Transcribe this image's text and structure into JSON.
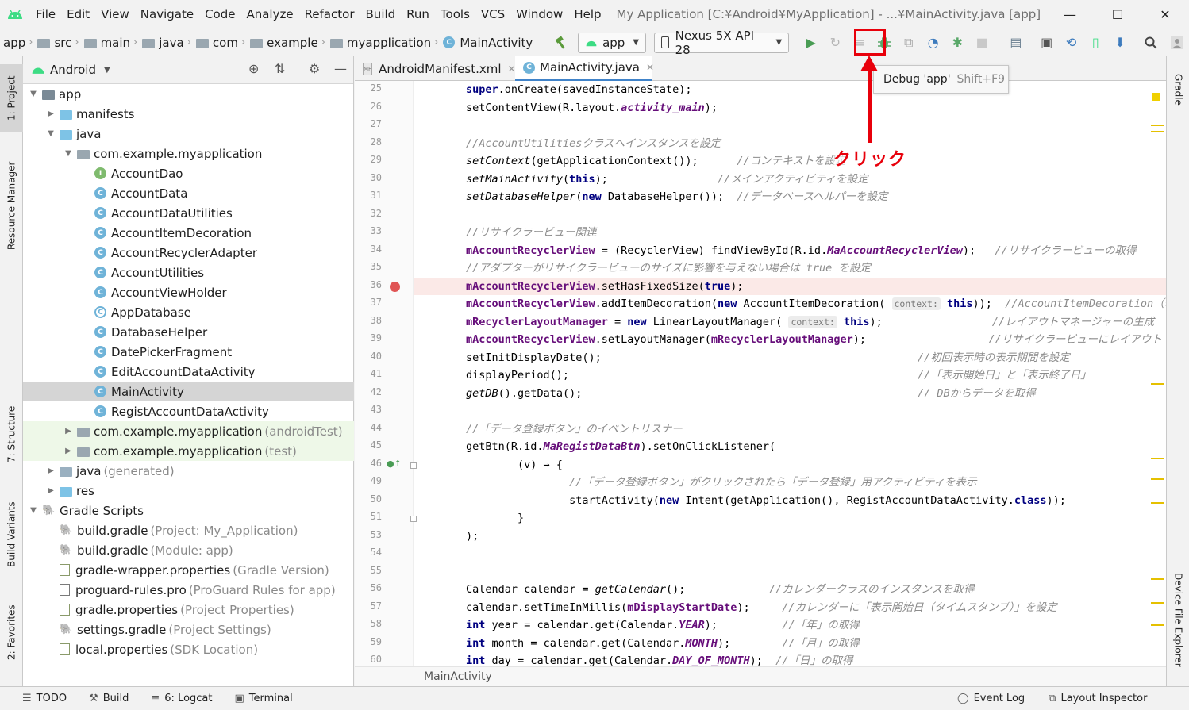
{
  "menubar": {
    "items": [
      {
        "label": "File"
      },
      {
        "label": "Edit"
      },
      {
        "label": "View"
      },
      {
        "label": "Navigate"
      },
      {
        "label": "Code"
      },
      {
        "label": "Analyze"
      },
      {
        "label": "Refactor"
      },
      {
        "label": "Build"
      },
      {
        "label": "Run"
      },
      {
        "label": "Tools"
      },
      {
        "label": "VCS"
      },
      {
        "label": "Window"
      },
      {
        "label": "Help"
      }
    ],
    "title": "My Application [C:¥Android¥MyApplication] - ...¥MainActivity.java [app]"
  },
  "navbar": {
    "crumbs": [
      "app",
      "src",
      "main",
      "java",
      "com",
      "example",
      "myapplication",
      "MainActivity"
    ],
    "run_config": "app",
    "device": "Nexus 5X API 28"
  },
  "tooltip": {
    "label": "Debug 'app'",
    "shortcut": "Shift+F9"
  },
  "annotation": {
    "text": "クリック",
    "color": "#e8000b"
  },
  "left_strip": {
    "tabs": [
      "1: Project",
      "Resource Manager",
      "7: Structure",
      "Build Variants",
      "2: Favorites"
    ]
  },
  "right_strip": {
    "tabs": [
      "Gradle",
      "Device File Explorer"
    ]
  },
  "project_panel": {
    "view": "Android",
    "tree": [
      {
        "label": "app",
        "hint": "",
        "type": "module",
        "indent": 0,
        "tw": "▼"
      },
      {
        "label": "manifests",
        "hint": "",
        "type": "folder",
        "indent": 1,
        "tw": "▶"
      },
      {
        "label": "java",
        "hint": "",
        "type": "folder",
        "indent": 1,
        "tw": "▼"
      },
      {
        "label": "com.example.myapplication",
        "hint": "",
        "type": "package",
        "indent": 2,
        "tw": "▼"
      },
      {
        "label": "AccountDao",
        "hint": "",
        "type": "interface",
        "indent": 3,
        "tw": ""
      },
      {
        "label": "AccountData",
        "hint": "",
        "type": "class",
        "indent": 3,
        "tw": ""
      },
      {
        "label": "AccountDataUtilities",
        "hint": "",
        "type": "class",
        "indent": 3,
        "tw": ""
      },
      {
        "label": "AccountItemDecoration",
        "hint": "",
        "type": "class",
        "indent": 3,
        "tw": ""
      },
      {
        "label": "AccountRecyclerAdapter",
        "hint": "",
        "type": "class",
        "indent": 3,
        "tw": ""
      },
      {
        "label": "AccountUtilities",
        "hint": "",
        "type": "class",
        "indent": 3,
        "tw": ""
      },
      {
        "label": "AccountViewHolder",
        "hint": "",
        "type": "class",
        "indent": 3,
        "tw": ""
      },
      {
        "label": "AppDatabase",
        "hint": "",
        "type": "abstract",
        "indent": 3,
        "tw": ""
      },
      {
        "label": "DatabaseHelper",
        "hint": "",
        "type": "class",
        "indent": 3,
        "tw": ""
      },
      {
        "label": "DatePickerFragment",
        "hint": "",
        "type": "class",
        "indent": 3,
        "tw": ""
      },
      {
        "label": "EditAccountDataActivity",
        "hint": "",
        "type": "class",
        "indent": 3,
        "tw": ""
      },
      {
        "label": "MainActivity",
        "hint": "",
        "type": "class",
        "indent": 3,
        "tw": "",
        "selected": true
      },
      {
        "label": "RegistAccountDataActivity",
        "hint": "",
        "type": "class",
        "indent": 3,
        "tw": ""
      },
      {
        "label": "com.example.myapplication",
        "hint": "(androidTest)",
        "type": "package",
        "indent": 2,
        "tw": "▶",
        "test": true
      },
      {
        "label": "com.example.myapplication",
        "hint": "(test)",
        "type": "package",
        "indent": 2,
        "tw": "▶",
        "test": true
      },
      {
        "label": "java",
        "hint": "(generated)",
        "type": "gen",
        "indent": 1,
        "tw": "▶"
      },
      {
        "label": "res",
        "hint": "",
        "type": "folder",
        "indent": 1,
        "tw": "▶"
      },
      {
        "label": "Gradle Scripts",
        "hint": "",
        "type": "gradle",
        "indent": 0,
        "tw": "▼"
      },
      {
        "label": "build.gradle",
        "hint": "(Project: My_Application)",
        "type": "gradle",
        "indent": 1,
        "tw": ""
      },
      {
        "label": "build.gradle",
        "hint": "(Module: app)",
        "type": "gradle",
        "indent": 1,
        "tw": ""
      },
      {
        "label": "gradle-wrapper.properties",
        "hint": "(Gradle Version)",
        "type": "props",
        "indent": 1,
        "tw": ""
      },
      {
        "label": "proguard-rules.pro",
        "hint": "(ProGuard Rules for app)",
        "type": "file",
        "indent": 1,
        "tw": ""
      },
      {
        "label": "gradle.properties",
        "hint": "(Project Properties)",
        "type": "props",
        "indent": 1,
        "tw": ""
      },
      {
        "label": "settings.gradle",
        "hint": "(Project Settings)",
        "type": "gradle",
        "indent": 1,
        "tw": ""
      },
      {
        "label": "local.properties",
        "hint": "(SDK Location)",
        "type": "props",
        "indent": 1,
        "tw": ""
      }
    ]
  },
  "editor": {
    "tabs": [
      {
        "label": "AndroidManifest.xml",
        "active": false
      },
      {
        "label": "MainActivity.java",
        "active": true
      }
    ],
    "line_numbers": [
      "25",
      "26",
      "27",
      "28",
      "29",
      "30",
      "31",
      "32",
      "33",
      "34",
      "35",
      "36",
      "37",
      "38",
      "39",
      "40",
      "41",
      "42",
      "43",
      "44",
      "45",
      "46",
      "49",
      "50",
      "51",
      "53",
      "54",
      "55",
      "56",
      "57",
      "58",
      "59",
      "60"
    ],
    "breakpoint_line": "36",
    "breadcrumb": "MainActivity",
    "lines": [
      [
        {
          "t": "        ",
          "c": ""
        },
        {
          "t": "super",
          "c": "kw"
        },
        {
          "t": ".onCreate(savedInstanceState);",
          "c": ""
        }
      ],
      [
        {
          "t": "        setContentView(R.layout.",
          "c": ""
        },
        {
          "t": "activity_main",
          "c": "fld ital"
        },
        {
          "t": ");",
          "c": ""
        }
      ],
      [],
      [
        {
          "t": "        //AccountUtilitiesクラスへインスタンスを設定",
          "c": "cm"
        }
      ],
      [
        {
          "t": "        ",
          "c": ""
        },
        {
          "t": "setContext",
          "c": "ital"
        },
        {
          "t": "(getApplicationContext());      ",
          "c": ""
        },
        {
          "t": "//コンテキストを設定",
          "c": "cm"
        }
      ],
      [
        {
          "t": "        ",
          "c": ""
        },
        {
          "t": "setMainActivity",
          "c": "ital"
        },
        {
          "t": "(",
          "c": ""
        },
        {
          "t": "this",
          "c": "kw"
        },
        {
          "t": ");                 ",
          "c": ""
        },
        {
          "t": "//メインアクティビティを設定",
          "c": "cm"
        }
      ],
      [
        {
          "t": "        ",
          "c": ""
        },
        {
          "t": "setDatabaseHelper",
          "c": "ital"
        },
        {
          "t": "(",
          "c": ""
        },
        {
          "t": "new",
          "c": "kw"
        },
        {
          "t": " DatabaseHelper());  ",
          "c": ""
        },
        {
          "t": "//データベースヘルパーを設定",
          "c": "cm"
        }
      ],
      [],
      [
        {
          "t": "        //リサイクラービュー関連",
          "c": "cm"
        }
      ],
      [
        {
          "t": "        ",
          "c": ""
        },
        {
          "t": "mAccountRecyclerView",
          "c": "fld"
        },
        {
          "t": " = (RecyclerView) findViewById(R.id.",
          "c": ""
        },
        {
          "t": "MaAccountRecyclerView",
          "c": "fld ital"
        },
        {
          "t": ");   ",
          "c": ""
        },
        {
          "t": "//リサイクラービューの取得",
          "c": "cm"
        }
      ],
      [
        {
          "t": "        //アダプターがリサイクラービューのサイズに影響を与えない場合は true を設定",
          "c": "cm"
        }
      ],
      [
        {
          "t": "        ",
          "c": ""
        },
        {
          "t": "mAccountRecyclerView",
          "c": "fld"
        },
        {
          "t": ".setHasFixedSize(",
          "c": ""
        },
        {
          "t": "true",
          "c": "kw"
        },
        {
          "t": ");",
          "c": ""
        }
      ],
      [
        {
          "t": "        ",
          "c": ""
        },
        {
          "t": "mAccountRecyclerView",
          "c": "fld"
        },
        {
          "t": ".addItemDecoration(",
          "c": ""
        },
        {
          "t": "new",
          "c": "kw"
        },
        {
          "t": " AccountItemDecoration( ",
          "c": ""
        },
        {
          "t": "context:",
          "c": "param"
        },
        {
          "t": " ",
          "c": ""
        },
        {
          "t": "this",
          "c": "kw"
        },
        {
          "t": "));  ",
          "c": ""
        },
        {
          "t": "//AccountItemDecoration（表示",
          "c": "cm"
        }
      ],
      [
        {
          "t": "        ",
          "c": ""
        },
        {
          "t": "mRecyclerLayoutManager",
          "c": "fld"
        },
        {
          "t": " = ",
          "c": ""
        },
        {
          "t": "new",
          "c": "kw"
        },
        {
          "t": " LinearLayoutManager( ",
          "c": ""
        },
        {
          "t": "context:",
          "c": "param"
        },
        {
          "t": " ",
          "c": ""
        },
        {
          "t": "this",
          "c": "kw"
        },
        {
          "t": ");                 ",
          "c": ""
        },
        {
          "t": "//レイアウトマネージャーの生成",
          "c": "cm"
        }
      ],
      [
        {
          "t": "        ",
          "c": ""
        },
        {
          "t": "mAccountRecyclerView",
          "c": "fld"
        },
        {
          "t": ".setLayoutManager(",
          "c": ""
        },
        {
          "t": "mRecyclerLayoutManager",
          "c": "fld"
        },
        {
          "t": ");                   ",
          "c": ""
        },
        {
          "t": "//リサイクラービューにレイアウト",
          "c": "cm"
        }
      ],
      [
        {
          "t": "        setInitDisplayDate();                                                 ",
          "c": ""
        },
        {
          "t": "//初回表示時の表示期間を設定",
          "c": "cm"
        }
      ],
      [
        {
          "t": "        displayPeriod();                                                      ",
          "c": ""
        },
        {
          "t": "//「表示開始日」と「表示終了日」",
          "c": "cm"
        }
      ],
      [
        {
          "t": "        ",
          "c": ""
        },
        {
          "t": "getDB",
          "c": "ital"
        },
        {
          "t": "().getData();                                                    ",
          "c": ""
        },
        {
          "t": "// DBからデータを取得",
          "c": "cm"
        }
      ],
      [],
      [
        {
          "t": "        //「データ登録ボタン」のイベントリスナー",
          "c": "cm"
        }
      ],
      [
        {
          "t": "        getBtn(R.id.",
          "c": ""
        },
        {
          "t": "MaRegistDataBtn",
          "c": "fld ital"
        },
        {
          "t": ").setOnClickListener(",
          "c": ""
        }
      ],
      [
        {
          "t": "                (v) → {",
          "c": ""
        }
      ],
      [
        {
          "t": "                        //「データ登録ボタン」がクリックされたら「データ登録」用アクティビティを表示",
          "c": "cm"
        }
      ],
      [
        {
          "t": "                        startActivity(",
          "c": ""
        },
        {
          "t": "new",
          "c": "kw"
        },
        {
          "t": " Intent(getApplication(), RegistAccountDataActivity.",
          "c": ""
        },
        {
          "t": "class",
          "c": "kw"
        },
        {
          "t": "));",
          "c": ""
        }
      ],
      [
        {
          "t": "                }",
          "c": ""
        }
      ],
      [
        {
          "t": "        );",
          "c": ""
        }
      ],
      [],
      [],
      [
        {
          "t": "        Calendar calendar = ",
          "c": ""
        },
        {
          "t": "getCalendar",
          "c": "ital"
        },
        {
          "t": "();             ",
          "c": ""
        },
        {
          "t": "//カレンダークラスのインスタンスを取得",
          "c": "cm"
        }
      ],
      [
        {
          "t": "        calendar.setTimeInMillis(",
          "c": ""
        },
        {
          "t": "mDisplayStartDate",
          "c": "fld"
        },
        {
          "t": ");     ",
          "c": ""
        },
        {
          "t": "//カレンダーに「表示開始日（タイムスタンプ）」を設定",
          "c": "cm"
        }
      ],
      [
        {
          "t": "        ",
          "c": ""
        },
        {
          "t": "int",
          "c": "kw"
        },
        {
          "t": " year = calendar.get(Calendar.",
          "c": ""
        },
        {
          "t": "YEAR",
          "c": "fld ital"
        },
        {
          "t": ");          ",
          "c": ""
        },
        {
          "t": "//「年」の取得",
          "c": "cm"
        }
      ],
      [
        {
          "t": "        ",
          "c": ""
        },
        {
          "t": "int",
          "c": "kw"
        },
        {
          "t": " month = calendar.get(Calendar.",
          "c": ""
        },
        {
          "t": "MONTH",
          "c": "fld ital"
        },
        {
          "t": ");        ",
          "c": ""
        },
        {
          "t": "//「月」の取得",
          "c": "cm"
        }
      ],
      [
        {
          "t": "        ",
          "c": ""
        },
        {
          "t": "int",
          "c": "kw"
        },
        {
          "t": " day = calendar.get(Calendar.",
          "c": ""
        },
        {
          "t": "DAY_OF_MONTH",
          "c": "fld ital"
        },
        {
          "t": ");  ",
          "c": ""
        },
        {
          "t": "//「日」の取得",
          "c": "cm"
        }
      ]
    ]
  },
  "statusbar": {
    "left": [
      {
        "icon": "list-icon",
        "label": "TODO"
      },
      {
        "icon": "hammer-icon",
        "label": "Build"
      },
      {
        "icon": "logcat-icon",
        "label": "6: Logcat"
      },
      {
        "icon": "terminal-icon",
        "label": "Terminal"
      }
    ],
    "right": [
      {
        "icon": "event-log-icon",
        "label": "Event Log"
      },
      {
        "icon": "layout-inspector-icon",
        "label": "Layout Inspector"
      }
    ]
  }
}
